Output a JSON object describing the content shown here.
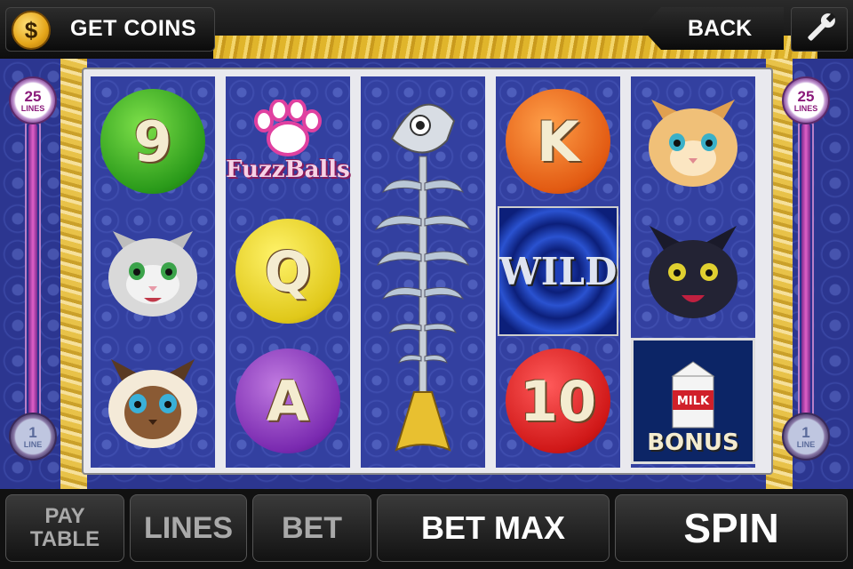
{
  "topbar": {
    "coin_symbol": "$",
    "get_coins_label": "GET COINS",
    "back_label": "BACK"
  },
  "meters": {
    "max_lines": "25",
    "max_unit": "LINES",
    "min_lines": "1",
    "min_unit": "LINE",
    "fill_level": 1.0
  },
  "reels": [
    [
      {
        "type": "yarn",
        "label": "9",
        "color": "green"
      },
      {
        "type": "cat",
        "icon": "gray-kitten-icon"
      },
      {
        "type": "cat",
        "icon": "siamese-cat-icon"
      }
    ],
    [
      {
        "type": "logo",
        "label": "FuzzBalls",
        "icon": "paw-print-icon"
      },
      {
        "type": "yarn",
        "label": "Q",
        "color": "yellow"
      },
      {
        "type": "yarn",
        "label": "A",
        "color": "purple"
      }
    ],
    [
      {
        "type": "fishbone",
        "icon": "fish-skeleton-icon"
      }
    ],
    [
      {
        "type": "yarn",
        "label": "K",
        "color": "orange"
      },
      {
        "type": "wild",
        "label": "WILD"
      },
      {
        "type": "yarn",
        "label": "10",
        "color": "red"
      }
    ],
    [
      {
        "type": "cat",
        "icon": "orange-kitten-icon"
      },
      {
        "type": "cat",
        "icon": "black-cat-icon"
      },
      {
        "type": "bonus",
        "label": "BONUS",
        "milk_label": "MILK"
      }
    ]
  ],
  "controls": {
    "pay_table_line1": "PAY",
    "pay_table_line2": "TABLE",
    "lines_label": "LINES",
    "bet_label": "BET",
    "bet_max_label": "BET MAX",
    "spin_label": "SPIN"
  },
  "colors": {
    "reel_bg": "#3340a0",
    "fur": "#e8c249",
    "meter_pink": "#e060c8"
  }
}
